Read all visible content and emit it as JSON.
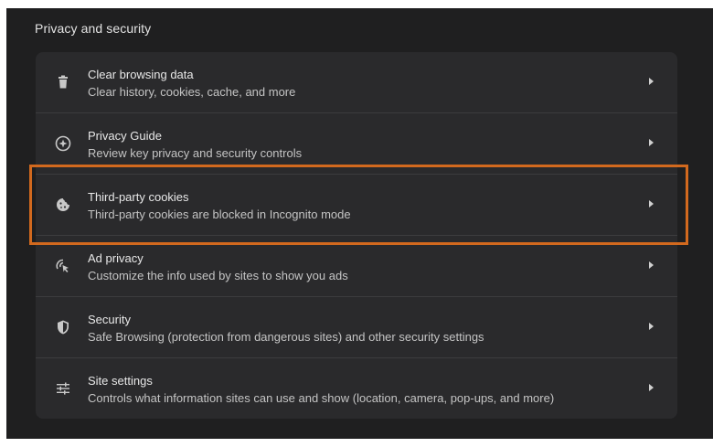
{
  "section": {
    "title": "Privacy and security"
  },
  "rows": [
    {
      "icon": "trash-icon",
      "title": "Clear browsing data",
      "desc": "Clear history, cookies, cache, and more"
    },
    {
      "icon": "compass-plus-icon",
      "title": "Privacy Guide",
      "desc": "Review key privacy and security controls"
    },
    {
      "icon": "cookie-icon",
      "title": "Third-party cookies",
      "desc": "Third-party cookies are blocked in Incognito mode"
    },
    {
      "icon": "ad-privacy-icon",
      "title": "Ad privacy",
      "desc": "Customize the info used by sites to show you ads"
    },
    {
      "icon": "shield-icon",
      "title": "Security",
      "desc": "Safe Browsing (protection from dangerous sites) and other security settings"
    },
    {
      "icon": "sliders-icon",
      "title": "Site settings",
      "desc": "Controls what information sites can use and show (location, camera, pop-ups, and more)"
    }
  ],
  "colors": {
    "background": "#1f1f20",
    "card": "#2a2a2c",
    "highlight": "#d2691e"
  }
}
